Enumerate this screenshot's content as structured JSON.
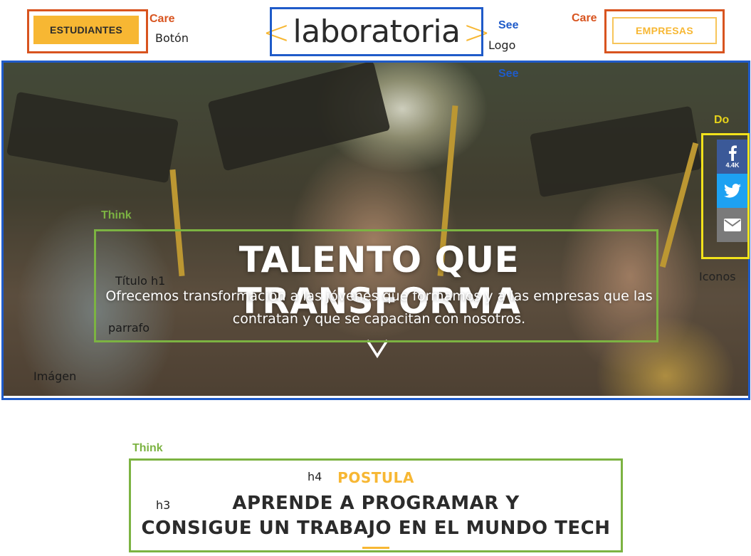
{
  "header": {
    "students_button": "ESTUDIANTES",
    "companies_button": "EMPRESAS",
    "logo": {
      "left_bracket": "<",
      "word": "laboratoria",
      "right_bracket": ">"
    }
  },
  "hero": {
    "title": "TALENTO QUE TRANSFORMA",
    "paragraph": "Ofrecemos transformación a las jóvenes que formamos y a las empresas que las contratan y que se capacitan con nosotros.",
    "chevron_icon": "chevron-down-icon"
  },
  "social": {
    "facebook_icon": "facebook-icon",
    "facebook_count": "4.4K",
    "twitter_icon": "twitter-icon",
    "email_icon": "email-icon"
  },
  "section": {
    "h4": "POSTULA",
    "h3_line1": "APRENDE A PROGRAMAR Y",
    "h3_line2": "CONSIGUE UN TRABAJO EN EL MUNDO TECH"
  },
  "annotations": {
    "care_left": "Care",
    "care_right": "Care",
    "see_logo": "See",
    "see_hero": "See",
    "think_hero": "Think",
    "think_section": "Think",
    "do_icons": "Do",
    "boton": "Botón",
    "logo": "Logo",
    "titulo_h1": "Título  h1",
    "parrafo": "parrafo",
    "imagen": "Imágen",
    "iconos": "Iconos",
    "h4": "h4",
    "h3": "h3"
  },
  "colors": {
    "accent_yellow": "#f7b733",
    "care": "#d8541f",
    "see": "#1f5bc9",
    "think": "#7cb342",
    "do": "#f2e21b",
    "facebook": "#3b5998",
    "twitter": "#1da1f2"
  }
}
